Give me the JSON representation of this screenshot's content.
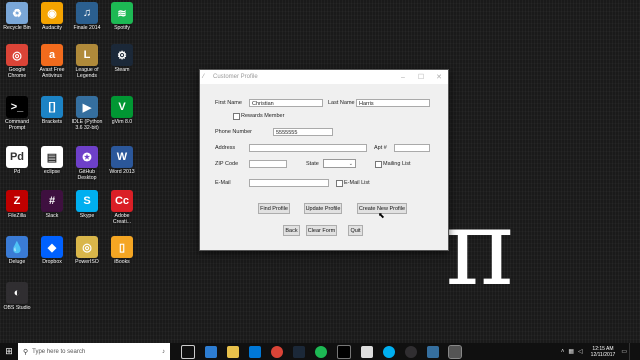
{
  "desktop": {
    "icons": [
      {
        "label": "Recycle Bin",
        "icon": "recycle-bin-icon",
        "color": "#7aa7d8",
        "glyph": "♻"
      },
      {
        "label": "Audacity",
        "icon": "audacity-icon",
        "color": "#f4a300",
        "glyph": "◉"
      },
      {
        "label": "Finale 2014",
        "icon": "finale-icon",
        "color": "#2b5f8f",
        "glyph": "♫"
      },
      {
        "label": "Spotify",
        "icon": "spotify-icon",
        "color": "#1db954",
        "glyph": "≋"
      },
      {
        "label": "Google Chrome",
        "icon": "chrome-icon",
        "color": "#db4437",
        "glyph": "◎"
      },
      {
        "label": "Avast Free Antivirus",
        "icon": "avast-icon",
        "color": "#f26b1d",
        "glyph": "a"
      },
      {
        "label": "League of Legends",
        "icon": "league-icon",
        "color": "#b08a3a",
        "glyph": "L"
      },
      {
        "label": "Steam",
        "icon": "steam-icon",
        "color": "#1b2838",
        "glyph": "⚙"
      },
      {
        "label": "Command Prompt",
        "icon": "cmd-icon",
        "color": "#000000",
        "glyph": ">_"
      },
      {
        "label": "Brackets",
        "icon": "brackets-icon",
        "color": "#1c83c5",
        "glyph": "[]"
      },
      {
        "label": "IDLE (Python 3.6 32-bit)",
        "icon": "idle-icon",
        "color": "#356f9f",
        "glyph": "▶"
      },
      {
        "label": "gVim 8.0",
        "icon": "gvim-icon",
        "color": "#019733",
        "glyph": "V"
      },
      {
        "label": "Pd",
        "icon": "pd-icon",
        "color": "#ffffff",
        "glyph": "Pd"
      },
      {
        "label": "eclipse",
        "icon": "eclipse-icon",
        "color": "#ffffff",
        "glyph": "▤"
      },
      {
        "label": "GitHub Desktop",
        "icon": "github-icon",
        "color": "#6e40c9",
        "glyph": "✪"
      },
      {
        "label": "Word 2013",
        "icon": "word-icon",
        "color": "#2b579a",
        "glyph": "W"
      },
      {
        "label": "FileZilla",
        "icon": "filezilla-icon",
        "color": "#bf0000",
        "glyph": "Z"
      },
      {
        "label": "Slack",
        "icon": "slack-icon",
        "color": "#3e103f",
        "glyph": "#"
      },
      {
        "label": "Skype",
        "icon": "skype-icon",
        "color": "#00aff0",
        "glyph": "S"
      },
      {
        "label": "Adobe Creati...",
        "icon": "adobe-cc-icon",
        "color": "#da1f26",
        "glyph": "Cc"
      },
      {
        "label": "Deluge",
        "icon": "deluge-icon",
        "color": "#3a7bd5",
        "glyph": "💧"
      },
      {
        "label": "Dropbox",
        "icon": "dropbox-icon",
        "color": "#0061ff",
        "glyph": "◆"
      },
      {
        "label": "PowerISO",
        "icon": "poweriso-icon",
        "color": "#d9b64a",
        "glyph": "◎"
      },
      {
        "label": "iBooks",
        "icon": "ibooks-icon",
        "color": "#f5a623",
        "glyph": "▯"
      },
      {
        "label": "OBS Studio",
        "icon": "obs-icon",
        "color": "#302e31",
        "glyph": "◐"
      }
    ]
  },
  "window": {
    "title": "Customer Profile",
    "fields": {
      "first_name_label": "First Name",
      "first_name_value": "Christian",
      "last_name_label": "Last Name",
      "last_name_value": "Harris",
      "rewards_label": "Rewards Member",
      "phone_label": "Phone Number",
      "phone_value": "5555555",
      "address_label": "Address",
      "apt_label": "Apt #",
      "zip_label": "ZIP Code",
      "state_label": "State",
      "mailing_label": "Mailing List",
      "email_label": "E-Mail",
      "email_list_label": "E-Mail List"
    },
    "buttons": {
      "find": "Find Profile",
      "update": "Update Profile",
      "create": "Create New Profile",
      "back": "Back",
      "clear": "Clear Form",
      "quit": "Quit"
    }
  },
  "wallpaper": {
    "glyph": "π"
  },
  "taskbar": {
    "search_placeholder": "Type here to search",
    "time": "12:15 AM",
    "date": "12/11/2017"
  }
}
